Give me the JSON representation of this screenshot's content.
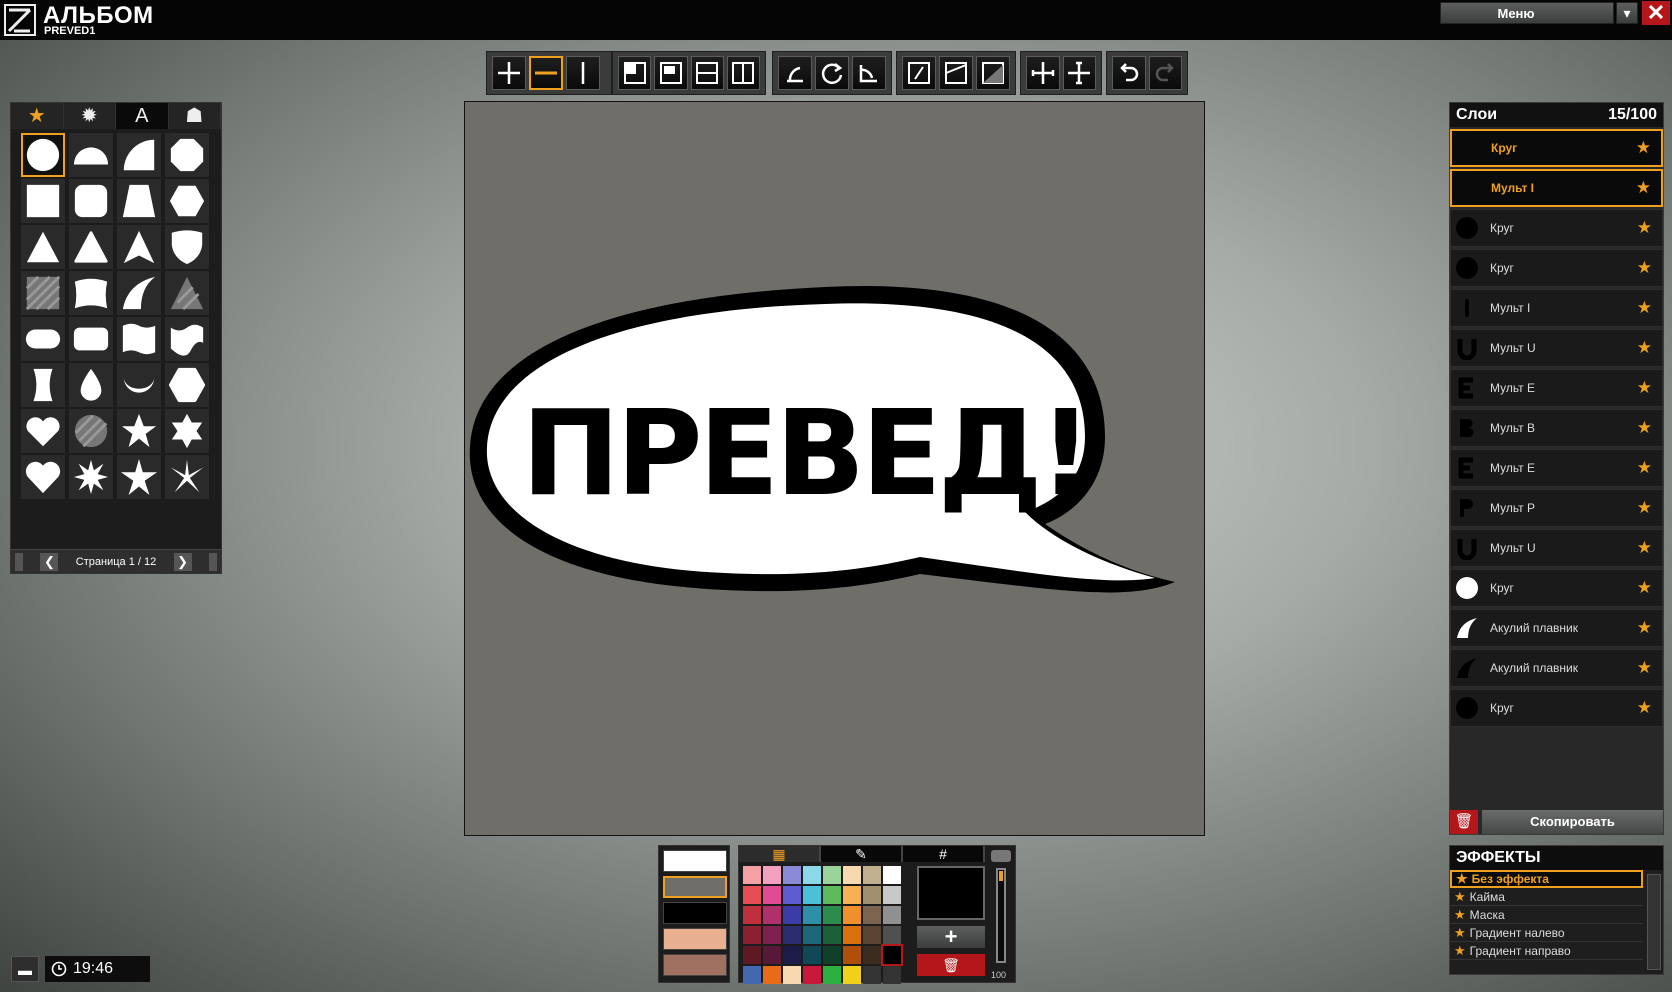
{
  "app": {
    "title": "АЛЬБОМ",
    "subtitle": "PREVED1"
  },
  "menu": {
    "label": "Меню",
    "dropdown_glyph": "▾",
    "close_glyph": "✕"
  },
  "shapes_panel": {
    "tabs": [
      "★",
      "✹",
      "A",
      "☗"
    ],
    "pager": {
      "text": "Страница 1 / 12",
      "prev": "❮",
      "next": "❯"
    }
  },
  "layers": {
    "title": "Слои",
    "count": "15/100",
    "items": [
      {
        "name": "Круг",
        "thumb": "none"
      },
      {
        "name": "Мульт I",
        "thumb": "none"
      },
      {
        "name": "Круг",
        "thumb": "black-circle"
      },
      {
        "name": "Круг",
        "thumb": "black-circle"
      },
      {
        "name": "Мульт I",
        "thumb": "I"
      },
      {
        "name": "Мульт U",
        "thumb": "U"
      },
      {
        "name": "Мульт E",
        "thumb": "E"
      },
      {
        "name": "Мульт B",
        "thumb": "B"
      },
      {
        "name": "Мульт E",
        "thumb": "E"
      },
      {
        "name": "Мульт P",
        "thumb": "P"
      },
      {
        "name": "Мульт U",
        "thumb": "U"
      },
      {
        "name": "Круг",
        "thumb": "white-circle"
      },
      {
        "name": "Акулий плавник",
        "thumb": "white-fin"
      },
      {
        "name": "Акулий плавник",
        "thumb": "black-fin"
      },
      {
        "name": "Круг",
        "thumb": "black-circle"
      }
    ],
    "star": "★",
    "copy_label": "Скопировать",
    "delete_glyph": "🗑"
  },
  "effects": {
    "title": "ЭФФЕКТЫ",
    "items": [
      "Без эффекта",
      "Кайма",
      "Маска",
      "Градиент налево",
      "Градиент направо"
    ]
  },
  "canvas": {
    "text": "ПРЕВЕД!"
  },
  "palette": {
    "tabs": [
      "▦",
      "✎",
      "#"
    ],
    "add_glyph": "+",
    "delete_glyph": "🗑",
    "opacity": "100",
    "colors": [
      "#f4a0a4",
      "#f4a0c0",
      "#8a8ad8",
      "#8ad8e8",
      "#9ad49a",
      "#f8d8b0",
      "#c0b090",
      "#ffffff",
      "#e84c54",
      "#e04c94",
      "#5c5cd0",
      "#4cc0d8",
      "#5cbc5c",
      "#f8b054",
      "#a09070",
      "#c8c8c8",
      "#c0303c",
      "#b0306c",
      "#3c3ca8",
      "#2c90a8",
      "#2c8c4c",
      "#f0902c",
      "#7c6450",
      "#909090",
      "#8c2030",
      "#802050",
      "#2c2c70",
      "#1c6878",
      "#1c6038",
      "#d8700c",
      "#5c4434",
      "#505050",
      "#601824",
      "#581838",
      "#1c1c48",
      "#104858",
      "#104028",
      "#b05008",
      "#3c2c20",
      "#000000",
      "#4468b0",
      "#e86c18",
      "#f8d8b0",
      "#c8183c",
      "#2cb040",
      "#f0d018",
      "#333333",
      "#333333"
    ],
    "swatches": [
      "#ffffff",
      "#6f6e69",
      "#000000",
      "#e8b090",
      "#a07060"
    ]
  },
  "status": {
    "time": "19:46"
  }
}
